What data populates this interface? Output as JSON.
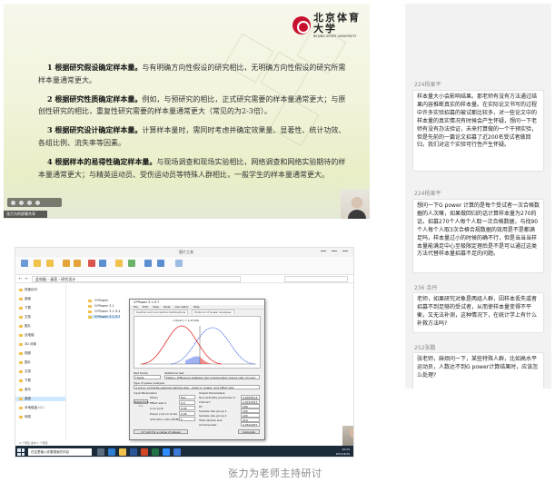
{
  "slide": {
    "logo": {
      "name_cn": "北京体育大学",
      "name_en": "BEIJING SPORT UNIVERSITY"
    },
    "points": [
      {
        "title": "1 根据研究假设确定样本量。",
        "body": "与有明确方向性假设的研究相比，无明确方向性假设的研究所需样本量通常更大。"
      },
      {
        "title": "2 根据研究性质确定样本量。",
        "body": "例如，与预研究的相比，正式研究需要的样本量通常更大；与原创性研究的相比，重复性研究需要的样本量通常更大（常见的为2-3倍）。"
      },
      {
        "title": "3 根据研究设计确定样本量。",
        "body": "计算样本量时，需同时考虑并确定效果量、显著性、统计功效、各组比例、流失率等因素。"
      },
      {
        "title": "4 根据样本的易得性确定样本量。",
        "body": "与现场调查和现场实验相比，网络调查和网络实验期待的样本量通常更大；与精英运动员、受伤运动员等特殊人群相比，一般学生的样本量通常更大。"
      }
    ],
    "presenter_tag": "张力为的屏幕共享"
  },
  "desktop": {
    "window_title": "图片工具",
    "address": "此电脑 › 桌面 › 研究设计",
    "nav_items": [
      "快速访问",
      "桌面",
      "下载",
      "文档",
      "图片",
      "此电脑",
      "3D 对象",
      "视频",
      "图片",
      "文档",
      "下载",
      "音乐",
      "桌面",
      "本地磁盘 (C:)",
      "网络"
    ],
    "files": [
      "G*Power",
      "G*Power 3.1",
      "G*Power 3.1.9.4",
      "G*Power 3.1.9.7"
    ],
    "status": "4 个项目   选中 1 个项目",
    "taskbar_search": "在这里输入你要搜索的内容",
    "clock_time": "10:24",
    "clock_date": "2021/4/20",
    "gpower": {
      "title": "G*Power 3.1.9.7",
      "menu": [
        "File",
        "Edit",
        "View",
        "Tests",
        "Calculator",
        "Help"
      ],
      "tabs": [
        "Central and noncentral distributions",
        "Protocol of power analyses"
      ],
      "chart_caption": "critical t = 1.97190",
      "test_family_label": "Test family",
      "test_family_value": "t tests",
      "stat_test_label": "Statistical test",
      "stat_test_value": "Means: Difference between two independent means (two groups)",
      "analysis_label": "Type of power analysis",
      "analysis_value": "A priori: Compute required sample size – given α, power, and effect size",
      "input_header": "Input Parameters",
      "output_header": "Output Parameters",
      "inputs": [
        {
          "label": "Tail(s)",
          "value": "Two"
        },
        {
          "label": "Effect size d",
          "value": "0.5"
        },
        {
          "label": "α err prob",
          "value": "0.05"
        },
        {
          "label": "Power (1-β err prob)",
          "value": "0.95"
        },
        {
          "label": "Allocation ratio N2/N1",
          "value": "1"
        }
      ],
      "outputs": [
        {
          "label": "Noncentrality parameter δ",
          "value": "3.6055513"
        },
        {
          "label": "Critical t",
          "value": "1.9714347"
        },
        {
          "label": "Df",
          "value": "206"
        },
        {
          "label": "Sample size group 1",
          "value": "105"
        },
        {
          "label": "Sample size group 2",
          "value": "105"
        },
        {
          "label": "Total sample size",
          "value": "210"
        },
        {
          "label": "Actual power",
          "value": "0.9501287"
        }
      ],
      "determine_label": "Determine =>",
      "xy_plot_label": "X-Y plot for a range of values",
      "calculate_label": "Calculate"
    }
  },
  "caption": "张力为老师主持研讨",
  "chat": {
    "messages": [
      {
        "name": "224杨果平",
        "text": "样本量大小会影响结果。那老师有没有方法通过结果内容推断真实的样本量。在实际论文书写的过程中许多实验招募的被试都比较多，对一些论文中的样本量的真实情况有时候会产生怀疑，想问一下老师有没有办法验证，未来打算做的一个干预实验，但是先前的一篇论文招募了近200名受试者做回归，我们对这个实验可行性产生怀疑。"
      },
      {
        "name": "224杨果平",
        "text": "想问一下G power 计算的是每个受试者一次合格数据的人次嘛，如果做回归的话计算样本量为270的话，招募270个人每个人取一次合格数据，与找90个人每个人取3次合格合规数据的效用是不是都满足吗，样本量过小的时候的确不行，但是当当当样本量能满足中心至极限定理后是不是可以通过这类方法代替样本量招募不足的问题。"
      },
      {
        "name": "236 余丹",
        "text": "老师，如果研究对象是两组人群，因样本丢失或者招募不到足够的受试者，从而使样本量变得不平衡，又无法补测，这种情况下，在统计学上有什么补救方法吗?"
      },
      {
        "name": "252张鹏",
        "text": "张老师，麻烦问一下，某些特殊人群，比如高水平运动员，人数达不到G power计算结果时，应该怎么处理?"
      }
    ]
  }
}
